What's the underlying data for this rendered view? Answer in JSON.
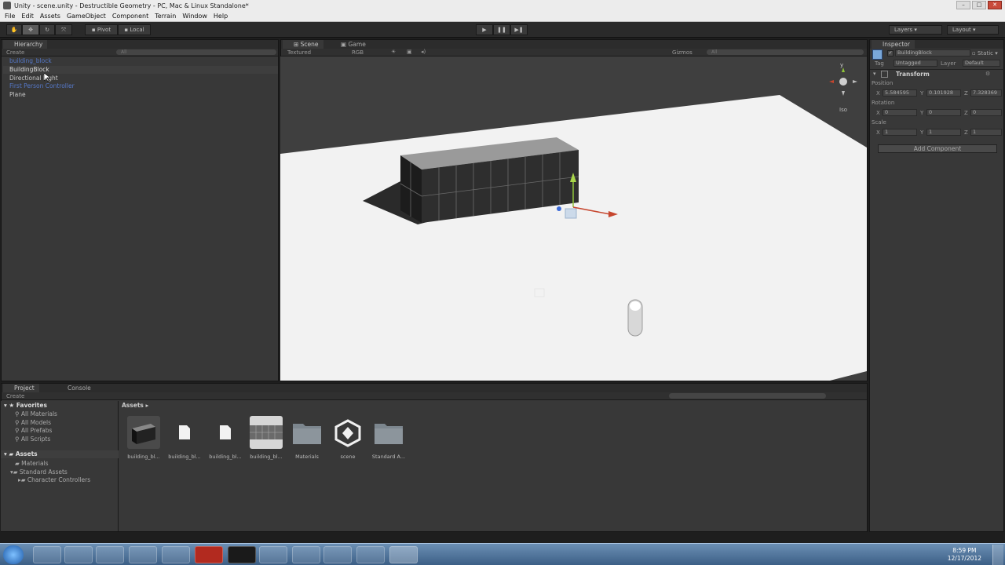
{
  "window": {
    "title": "Unity - scene.unity - Destructible Geometry - PC, Mac & Linux Standalone*"
  },
  "menu": [
    "File",
    "Edit",
    "Assets",
    "GameObject",
    "Component",
    "Terrain",
    "Window",
    "Help"
  ],
  "toolbar": {
    "pivot": "Pivot",
    "local": "Local",
    "layers": "Layers",
    "layout": "Layout"
  },
  "hierarchy": {
    "tab": "Hierarchy",
    "create": "Create",
    "search": "All",
    "items": [
      {
        "label": "building_block",
        "prefab": true
      },
      {
        "label": "BuildingBlock",
        "prefab": false
      },
      {
        "label": "Directional Light",
        "prefab": false
      },
      {
        "label": "First Person Controller",
        "prefab": true
      },
      {
        "label": "Plane",
        "prefab": false
      }
    ]
  },
  "scene": {
    "tab_scene": "Scene",
    "tab_game": "Game",
    "render_mode": "Textured",
    "color_mode": "RGB",
    "gizmos": "Gizmos",
    "gizmos_search": "All",
    "persp": "Iso",
    "axis_y": "y"
  },
  "inspector": {
    "tab": "Inspector",
    "object_name": "BuildingBlock",
    "static": "Static",
    "tag_label": "Tag",
    "tag_value": "Untagged",
    "layer_label": "Layer",
    "layer_value": "Default",
    "component": "Transform",
    "position_label": "Position",
    "rotation_label": "Rotation",
    "scale_label": "Scale",
    "position": {
      "x": "5.584595",
      "y": "0.101928",
      "z": "7.328369"
    },
    "rotation": {
      "x": "0",
      "y": "0",
      "z": "0"
    },
    "scale": {
      "x": "1",
      "y": "1",
      "z": "1"
    },
    "add_component": "Add Component"
  },
  "project": {
    "tab_project": "Project",
    "tab_console": "Console",
    "create": "Create",
    "favorites": "Favorites",
    "fav_items": [
      "All Materials",
      "All Models",
      "All Prefabs",
      "All Scripts"
    ],
    "assets_root": "Assets",
    "tree": [
      "Materials",
      "Standard Assets",
      "Character Controllers"
    ],
    "breadcrumb": "Assets",
    "assets": [
      {
        "name": "building_bl...",
        "kind": "model"
      },
      {
        "name": "building_bl...",
        "kind": "file"
      },
      {
        "name": "building_bl...",
        "kind": "file"
      },
      {
        "name": "building_bl...",
        "kind": "texture"
      },
      {
        "name": "Materials",
        "kind": "folder"
      },
      {
        "name": "scene",
        "kind": "unity"
      },
      {
        "name": "Standard A...",
        "kind": "folder"
      }
    ]
  },
  "taskbar": {
    "time": "8:59 PM",
    "date": "12/17/2012"
  }
}
